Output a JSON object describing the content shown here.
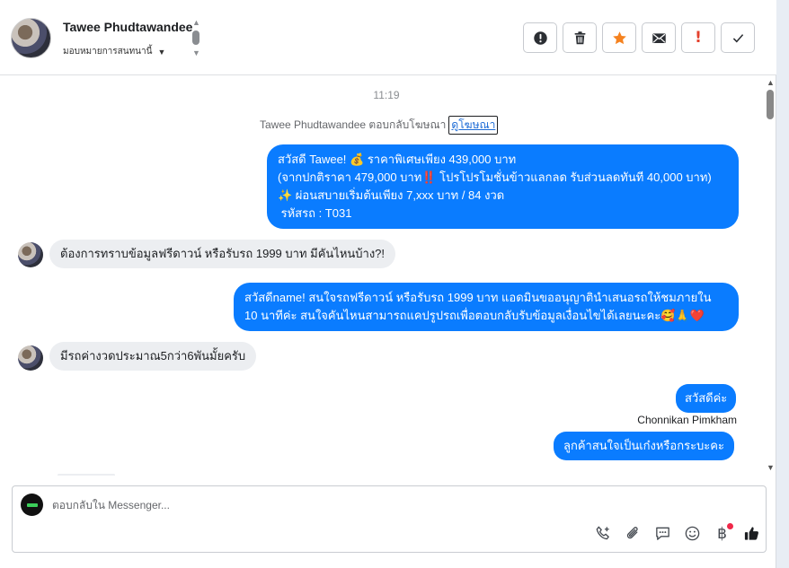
{
  "header": {
    "contact_name": "Tawee Phudtawandee",
    "assign_label": "มอบหมายการสนทนานี้"
  },
  "actions": [
    {
      "name": "spam-button",
      "icon": "alert-circle-icon"
    },
    {
      "name": "delete-button",
      "icon": "trash-icon"
    },
    {
      "name": "star-button",
      "icon": "star-icon",
      "color": "#f5821f"
    },
    {
      "name": "email-button",
      "icon": "envelope-icon"
    },
    {
      "name": "mark-important-button",
      "icon": "exclamation-icon",
      "text": "!",
      "color": "#e4412d"
    },
    {
      "name": "done-button",
      "icon": "check-icon"
    }
  ],
  "thread": {
    "timestamp": "11:19",
    "system_prefix": "Tawee Phudtawandee ตอบกลับโฆษณา",
    "system_link": "ดูโฆษณา",
    "messages": [
      {
        "dir": "out",
        "lines": [
          "สวัสดี Tawee! 💰 ราคาพิเศษเพียง 439,000 บาท",
          "(จากปกติราคา 479,000 บาท‼️ โปรโปรโมชั่นข้าวแลกลด รับส่วนลดทันที 40,000 บาท)",
          "✨ ผ่อนสบายเริ่มต้นเพียง 7,xxx บาท / 84 งวด",
          " รหัสรถ : T031"
        ]
      },
      {
        "dir": "in",
        "lines": [
          "ต้องการทราบข้อมูลฟรีดาวน์ หรือรับรถ 1999 บาท มีคันไหนบ้าง?!"
        ]
      },
      {
        "dir": "out",
        "lines": [
          "สวัสดีname! สนใจรถฟรีดาวน์ หรือรับรถ 1999 บาท แอดมินขออนุญาตินำเสนอรถให้ชมภายใน",
          "10 นาทีค่ะ สนใจคันไหนสามารถแคปรูปรถเพื่อตอบกลับรับข้อมูลเงื่อนไขได้เลยนะคะ🥰🙏❤️"
        ]
      },
      {
        "dir": "in",
        "lines": [
          "มีรถค่างวดประมาณ5กว่า6พันมั้ยครับ"
        ]
      },
      {
        "dir": "out",
        "lines": [
          "สวัสดีค่ะ"
        ]
      },
      {
        "dir": "sender",
        "lines": [
          "Chonnikan Pimkham"
        ]
      },
      {
        "dir": "out",
        "lines": [
          "ลูกค้าสนใจเป็นเก๋งหรือกระบะคะ"
        ]
      }
    ]
  },
  "composer": {
    "placeholder": "ตอบกลับใน Messenger...",
    "tools": [
      {
        "name": "call-icon"
      },
      {
        "name": "attachment-icon"
      },
      {
        "name": "saved-reply-icon"
      },
      {
        "name": "emoji-icon"
      },
      {
        "name": "payment-icon",
        "text": "฿",
        "badge_color": "#f02849"
      },
      {
        "name": "like-icon"
      }
    ]
  }
}
